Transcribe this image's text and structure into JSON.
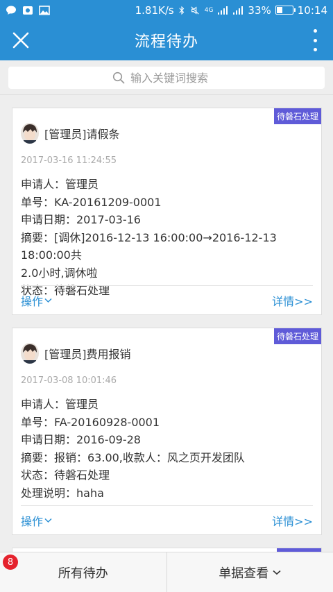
{
  "status_bar": {
    "speed": "1.81K/s",
    "network": "4G",
    "battery_percent": "33%",
    "battery_level": 0.33,
    "time": "10:14"
  },
  "header": {
    "title": "流程待办",
    "close_icon": "close-icon",
    "more_icon": "more-vertical-icon"
  },
  "search": {
    "placeholder": "输入关键词搜索",
    "icon": "search-icon"
  },
  "cards": [
    {
      "title": "[管理员]请假条",
      "badge": "待磐石处理",
      "time": "2017-03-16 11:24:55",
      "fields": [
        "申请人：管理员",
        "单号：KA-20161209-0001",
        "申请日期：2017-03-16",
        "摘要：[调休]2016-12-13 16:00:00→2016-12-13 18:00:00共",
        "2.0小时,调休啦",
        "状态：待磐石处理"
      ],
      "action_label": "操作",
      "details_label": "详情>>"
    },
    {
      "title": "[管理员]费用报销",
      "badge": "待磐石处理",
      "time": "2017-03-08 10:01:46",
      "fields": [
        "申请人：管理员",
        "单号：FA-20160928-0001",
        "申请日期：2016-09-28",
        "摘要：报销：63.00,收款人：风之页开发团队",
        "状态：待磐石处理",
        "处理说明：haha"
      ],
      "action_label": "操作",
      "details_label": "详情>>"
    }
  ],
  "bottom_bar": {
    "tab_all": "所有待办",
    "tab_all_count": "8",
    "tab_view": "单据查看"
  },
  "colors": {
    "accent": "#2a8fd4",
    "badge": "#5f5bd8",
    "count_badge": "#e5222d"
  }
}
